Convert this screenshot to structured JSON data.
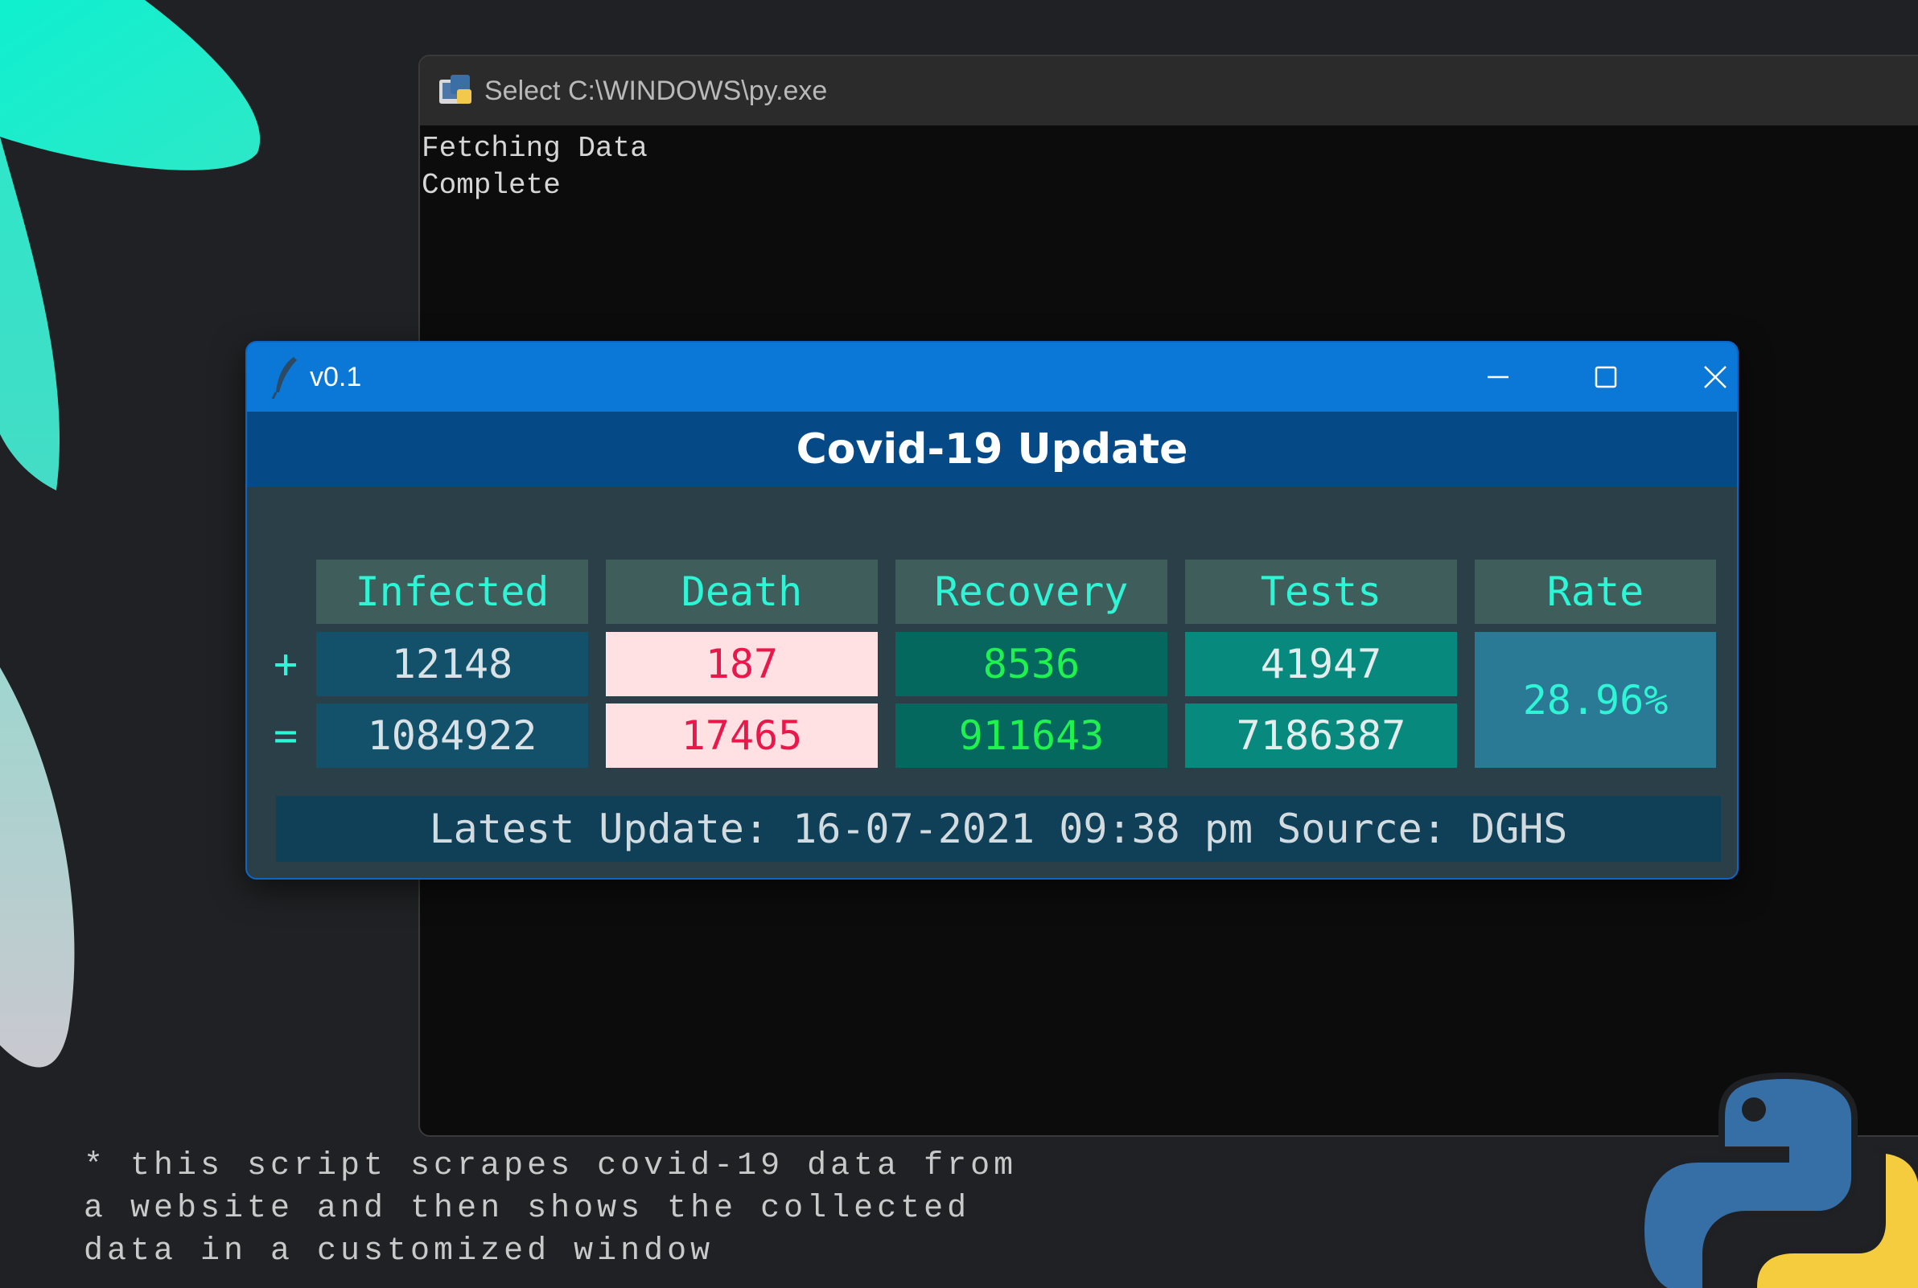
{
  "console": {
    "title": "Select C:\\WINDOWS\\py.exe",
    "lines": [
      "Fetching Data",
      "Complete"
    ]
  },
  "window": {
    "title": "v0.1",
    "controls": {
      "minimize_icon": "minimize-icon",
      "maximize_icon": "maximize-icon",
      "close_icon": "close-icon"
    }
  },
  "app": {
    "heading": "Covid-19 Update",
    "columns": [
      "Infected",
      "Death",
      "Recovery",
      "Tests",
      "Rate"
    ],
    "rows": [
      {
        "sign": "+",
        "values": [
          "12148",
          "187",
          "8536",
          "41947"
        ]
      },
      {
        "sign": "=",
        "values": [
          "1084922",
          "17465",
          "911643",
          "7186387"
        ]
      }
    ],
    "rate": "28.96%",
    "footer": "Latest Update: 16-07-2021 09:38 pm Source: DGHS"
  },
  "caption": {
    "lines": [
      "* this script scrapes covid-19 data from",
      "a website and then shows the collected",
      "data in a customized window"
    ]
  },
  "colors": {
    "accent_cyan": "#2ef5d6",
    "titlebar_blue": "#0b78d8",
    "header_blue": "#054a86",
    "death_bg": "#ffe1e4",
    "death_text": "#e8194a",
    "recovery_text": "#1ff24f"
  }
}
